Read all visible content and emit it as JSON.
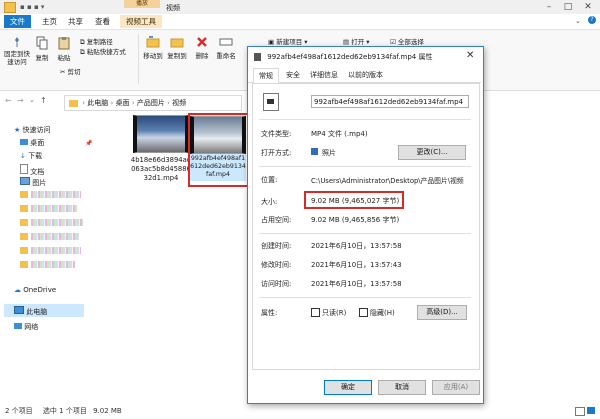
{
  "window": {
    "title_fragment": "视频",
    "context_tab": "播放"
  },
  "ribbon_tabs": [
    "文件",
    "主页",
    "共享",
    "查看",
    "视频工具"
  ],
  "ribbon": {
    "pin_quick_access": "固定到快速访问",
    "copy": "复制",
    "paste": "粘贴",
    "copy_path": "复制路径",
    "paste_shortcut": "粘贴快捷方式",
    "cut": "剪切",
    "move_to": "移动到",
    "copy_to": "复制到",
    "delete": "删除",
    "rename": "重命名",
    "new_item": "新建项目",
    "open": "打开",
    "select_all": "全部选择"
  },
  "address": {
    "crumbs": [
      "此电脑",
      "桌面",
      "产品图片",
      "视频"
    ]
  },
  "nav": {
    "quick_access": "快速访问",
    "desktop": "桌面",
    "downloads": "下载",
    "documents": "文档",
    "pictures": "图片",
    "onedrive": "OneDrive",
    "this_pc": "此电脑",
    "network": "网络"
  },
  "files": [
    {
      "name": "4b18e66d3894ad063ac5b8d4588632d1.mp4"
    },
    {
      "name": "992afb4ef498af1612ded62eb9134faf.mp4"
    }
  ],
  "status": {
    "items": "2 个项目",
    "selected": "选中 1 个项目",
    "size": "9.02 MB"
  },
  "dialog": {
    "title": "992afb4ef498af1612ded62eb9134faf.mp4 属性",
    "tabs": [
      "常规",
      "安全",
      "详细信息",
      "以前的版本"
    ],
    "filename": "992afb4ef498af1612ded62eb9134faf.mp4",
    "file_type_label": "文件类型:",
    "file_type_value": "MP4 文件 (.mp4)",
    "open_with_label": "打开方式:",
    "open_with_value": "照片",
    "change_button": "更改(C)...",
    "location_label": "位置:",
    "location_value": "C:\\Users\\Administrator\\Desktop\\产品图片\\视频",
    "size_label": "大小:",
    "size_value": "9.02 MB (9,465,027 字节)",
    "disk_size_label": "占用空间:",
    "disk_size_value": "9.02 MB (9,465,856 字节)",
    "created_label": "创建时间:",
    "created_value": "2021年6月10日，13:57:58",
    "modified_label": "修改时间:",
    "modified_value": "2021年6月10日，13:57:43",
    "accessed_label": "访问时间:",
    "accessed_value": "2021年6月10日，13:57:58",
    "attributes_label": "属性:",
    "readonly_label": "只读(R)",
    "hidden_label": "隐藏(H)",
    "advanced_button": "高级(D)...",
    "ok_button": "确定",
    "cancel_button": "取消",
    "apply_button": "应用(A)"
  },
  "colors": {
    "accent": "#1979ca",
    "highlight_box": "#d42b2b",
    "nav_selected": "#cce8ff",
    "context_tab": "#fbe7c4"
  }
}
